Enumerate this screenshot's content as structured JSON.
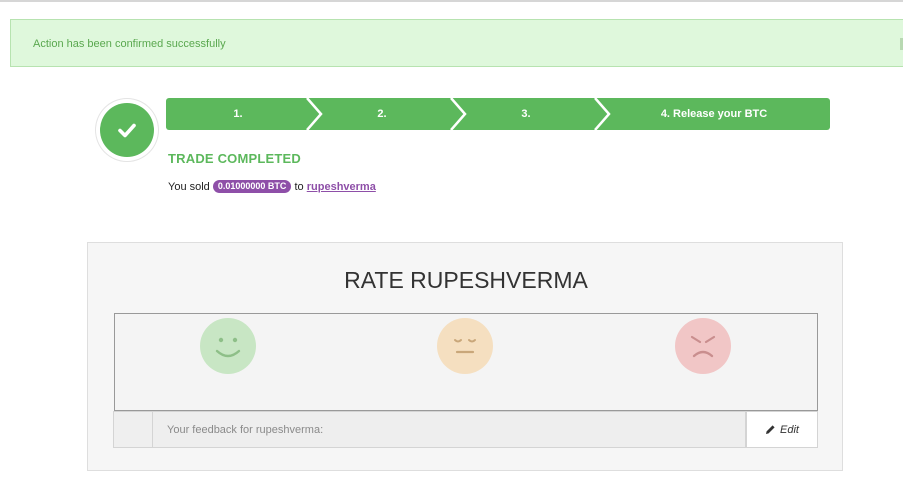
{
  "alert": {
    "message": "Action has been confirmed successfully"
  },
  "steps": [
    {
      "label": "1."
    },
    {
      "label": "2."
    },
    {
      "label": "3."
    },
    {
      "label": "4.  Release your BTC"
    }
  ],
  "trade": {
    "title": "TRADE COMPLETED",
    "prefix": "You sold",
    "amount": "0.01000000 BTC",
    "to": "to",
    "user": "rupeshverma"
  },
  "rating": {
    "title": "RATE RUPESHVERMA",
    "feedback_placeholder": "Your feedback for rupeshverma:",
    "edit_label": "Edit"
  },
  "colors": {
    "success": "#5cb85c",
    "alert_bg": "#dff8dc",
    "badge": "#8e4fa8",
    "positive_face": "#c8e6c4",
    "neutral_face": "#f5dfc0",
    "negative_face": "#f1c6c6"
  },
  "icons": {
    "check": "check-icon",
    "positive": "smile-face-icon",
    "neutral": "neutral-face-icon",
    "negative": "angry-face-icon",
    "edit": "pencil-icon"
  }
}
